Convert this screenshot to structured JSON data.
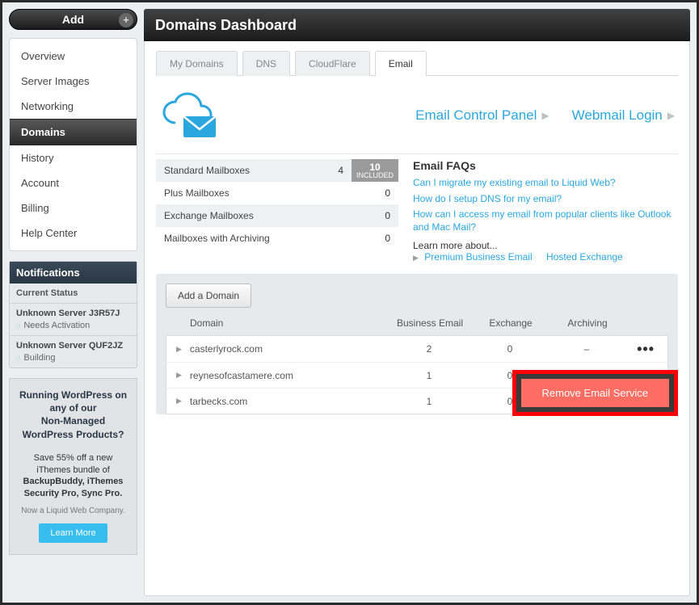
{
  "header": {
    "add_label": "Add",
    "title": "Domains Dashboard"
  },
  "nav": {
    "items": [
      {
        "label": "Overview"
      },
      {
        "label": "Server Images"
      },
      {
        "label": "Networking"
      },
      {
        "label": "Domains",
        "active": true
      },
      {
        "label": "History"
      },
      {
        "label": "Account"
      },
      {
        "label": "Billing"
      },
      {
        "label": "Help Center"
      }
    ]
  },
  "notifications": {
    "title": "Notifications",
    "status_label": "Current Status",
    "items": [
      {
        "name": "Unknown Server J3R57J",
        "status": "Needs Activation"
      },
      {
        "name": "Unknown Server QUF2JZ",
        "status": "Building"
      }
    ]
  },
  "promo": {
    "line1": "Running WordPress on any of our",
    "line2": "Non-Managed WordPress Products?",
    "body1": "Save 55% off a new iThemes bundle of",
    "body2": "BackupBuddy, iThemes Security Pro, Sync Pro.",
    "small": "Now a Liquid Web Company.",
    "button": "Learn More"
  },
  "tabs": [
    {
      "label": "My Domains"
    },
    {
      "label": "DNS"
    },
    {
      "label": "CloudFlare"
    },
    {
      "label": "Email",
      "active": true
    }
  ],
  "hero": {
    "link1": "Email Control Panel",
    "link2": "Webmail Login"
  },
  "mailboxes": [
    {
      "label": "Standard Mailboxes",
      "value": "4",
      "badge_count": "10",
      "badge_text": "INCLUDED"
    },
    {
      "label": "Plus Mailboxes",
      "value": "0"
    },
    {
      "label": "Exchange Mailboxes",
      "value": "0"
    },
    {
      "label": "Mailboxes with Archiving",
      "value": "0"
    }
  ],
  "faqs": {
    "title": "Email FAQs",
    "items": [
      "Can I migrate my existing email to Liquid Web?",
      "How do I setup DNS for my email?",
      "How can I access my email from popular clients like Outlook and Mac Mail?"
    ],
    "learn_label": "Learn more about...",
    "sublinks": [
      "Premium Business Email",
      "Hosted Exchange"
    ]
  },
  "domain_area": {
    "add_button": "Add a Domain",
    "columns": {
      "domain": "Domain",
      "be": "Business Email",
      "ex": "Exchange",
      "ar": "Archiving"
    },
    "rows": [
      {
        "domain": "casterlyrock.com",
        "be": "2",
        "ex": "0",
        "ar": "–"
      },
      {
        "domain": "reynesofcastamere.com",
        "be": "1",
        "ex": "0",
        "ar": "–"
      },
      {
        "domain": "tarbecks.com",
        "be": "1",
        "ex": "0",
        "ar": "–"
      }
    ],
    "popover": {
      "remove": "Remove Email Service"
    }
  }
}
